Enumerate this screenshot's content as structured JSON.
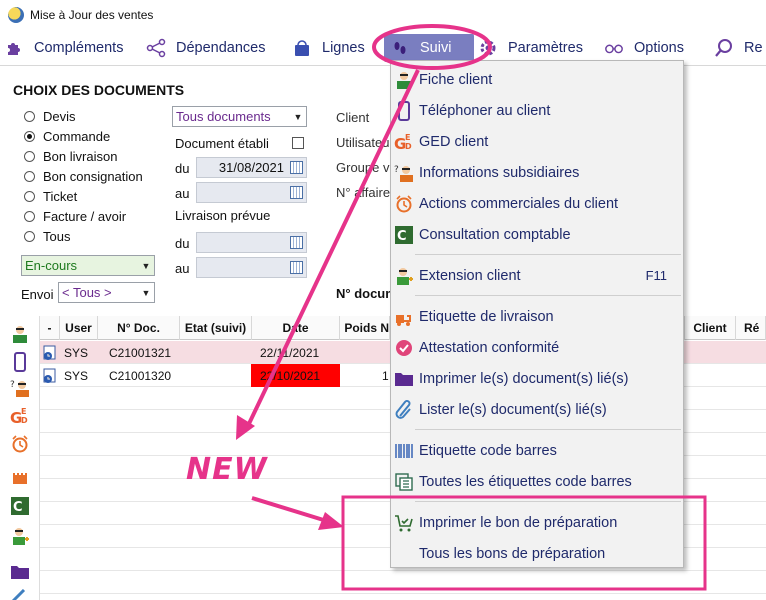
{
  "window": {
    "title": "Mise à Jour des ventes"
  },
  "menubar": {
    "items": [
      "Compléments",
      "Dépendances",
      "Lignes",
      "Suivi",
      "Paramètres",
      "Options",
      "Re"
    ]
  },
  "filters": {
    "section_title": "CHOIX DES DOCUMENTS",
    "radios": [
      "Devis",
      "Commande",
      "Bon livraison",
      "Bon consignation",
      "Ticket",
      "Facture / avoir",
      "Tous"
    ],
    "selected_radio": "Commande",
    "type_combo": "Tous documents",
    "document_etabli_label": "Document établi",
    "du_label": "du",
    "au_label": "au",
    "date_du": "31/08/2021",
    "date_au": "",
    "livraison_label": "Livraison prévue",
    "liv_du_label": "du",
    "liv_au_label": "au",
    "status_combo": "En-cours",
    "envoi_label": "Envoi",
    "envoi_combo": "< Tous >",
    "client_label": "Client",
    "utilisateur_label": "Utilisateur",
    "groupe_label": "Groupe v",
    "affaire_label": "N° affaire",
    "ndoc_label": "N° docum"
  },
  "grid": {
    "columns": [
      "-",
      "User",
      "N° Doc.",
      "Etat (suivi)",
      "Date",
      "Poids N",
      "Client",
      "Ré"
    ],
    "rows": [
      {
        "user": "SYS",
        "doc": "C21001321",
        "etat": "",
        "date": "22/11/2021",
        "poids": ""
      },
      {
        "user": "SYS",
        "doc": "C21001320",
        "etat": "",
        "date": "22/10/2021",
        "poids": "1"
      }
    ]
  },
  "dropdown": {
    "items": [
      {
        "label": "Fiche client",
        "icon": "person-card-icon",
        "key": ""
      },
      {
        "label": "Téléphoner au client",
        "icon": "phone-icon",
        "key": ""
      },
      {
        "label": "GED client",
        "icon": "ged-icon",
        "key": ""
      },
      {
        "label": "Informations subsidiaires",
        "icon": "person-info-icon",
        "key": ""
      },
      {
        "label": "Actions commerciales du client",
        "icon": "alarm-clock-icon",
        "key": ""
      },
      {
        "label": "Consultation comptable",
        "icon": "ledger-icon",
        "key": ""
      },
      {
        "label": "Extension client",
        "icon": "person-plus-icon",
        "key": "F11"
      },
      {
        "label": "Etiquette de livraison",
        "icon": "delivery-label-icon",
        "key": ""
      },
      {
        "label": "Attestation conformité",
        "icon": "check-badge-icon",
        "key": ""
      },
      {
        "label": "Imprimer le(s) document(s) lié(s)",
        "icon": "folder-icon",
        "key": ""
      },
      {
        "label": "Lister le(s) document(s) lié(s)",
        "icon": "paperclip-icon",
        "key": ""
      },
      {
        "label": "Etiquette code barres",
        "icon": "barcode-icon",
        "key": ""
      },
      {
        "label": "Toutes les étiquettes code barres",
        "icon": "barcode-list-icon",
        "key": ""
      },
      {
        "label": "Imprimer le bon de préparation",
        "icon": "cart-check-icon",
        "key": ""
      },
      {
        "label": "Tous les bons de préparation",
        "icon": "",
        "key": ""
      }
    ]
  },
  "annotation": {
    "label": "NEW",
    "color": "#e6338a"
  },
  "colors": {
    "menu_text": "#1f2a6b",
    "active_menu": "#7a7ec0",
    "highlight": "#e6338a",
    "row_pink": "#f6dde2",
    "cell_red": "#ff0000"
  }
}
